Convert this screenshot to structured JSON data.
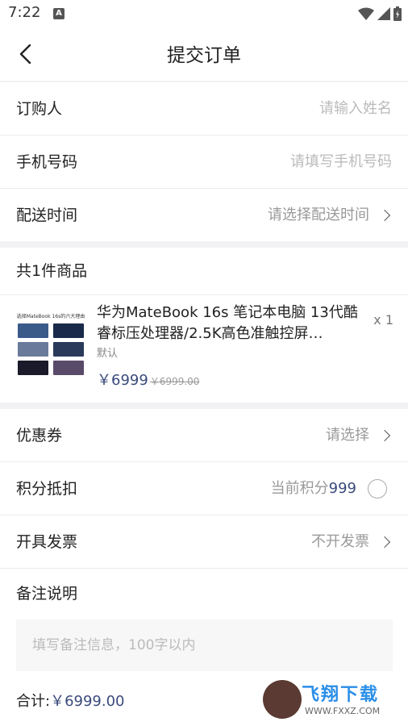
{
  "status": {
    "time": "7:22",
    "app_icon": "A"
  },
  "nav": {
    "title": "提交订单"
  },
  "form": {
    "buyer_label": "订购人",
    "buyer_placeholder": "请输入姓名",
    "phone_label": "手机号码",
    "phone_placeholder": "请填写手机号码",
    "delivery_label": "配送时间",
    "delivery_placeholder": "请选择配送时间"
  },
  "goods": {
    "header": "共1件商品",
    "title": "华为MateBook 16s 笔记本电脑 13代酷睿标压处理器/2.5K高色准触控屏…",
    "spec": "默认",
    "price": "￥6999",
    "old_price": "￥6999.00",
    "qty": "x 1",
    "thumb_caption": "选择MateBook 16s的六大理由"
  },
  "options": {
    "coupon_label": "优惠券",
    "coupon_value": "请选择",
    "points_label": "积分抵扣",
    "points_prefix": "当前积分",
    "points_value": "999",
    "invoice_label": "开具发票",
    "invoice_value": "不开发票",
    "remark_label": "备注说明",
    "remark_placeholder": "填写备注信息，100字以内"
  },
  "footer": {
    "total_label": "合计:",
    "total_amount": "￥6999.00"
  },
  "watermark": {
    "text": "飞翔下载",
    "url": "WWW.FXXZ.COM"
  },
  "colors": {
    "accent": "#3a4a7a",
    "background": "#f2f2f4"
  }
}
